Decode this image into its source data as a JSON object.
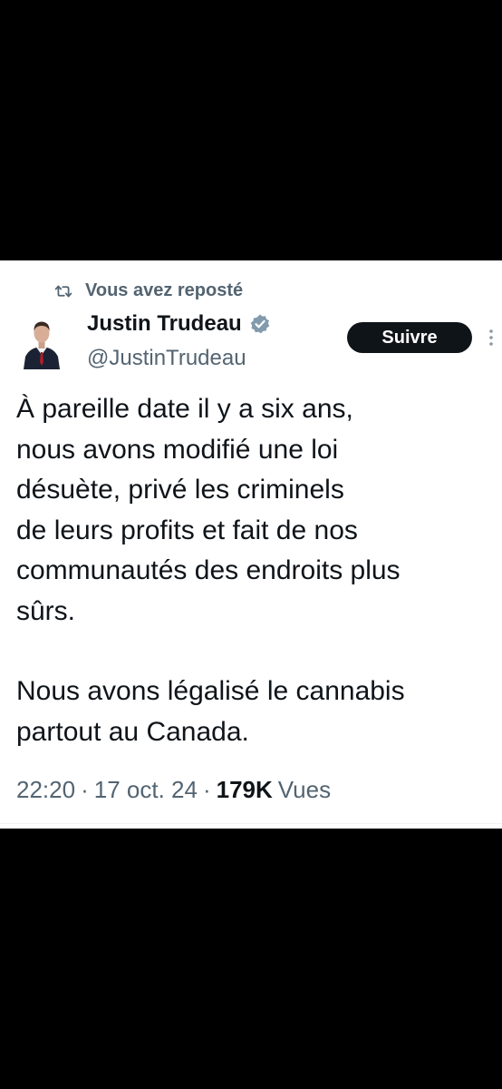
{
  "repost": {
    "label": "Vous avez reposté",
    "icon": "repost-icon"
  },
  "author": {
    "name": "Justin Trudeau",
    "handle": "@JustinTrudeau",
    "verified_icon": "verified-badge-icon",
    "verified_color": "#829aab"
  },
  "follow_button": {
    "label": "Suivre"
  },
  "more_menu": {
    "icon": "more-vertical-icon"
  },
  "tweet": {
    "paragraphs": [
      [
        "À pareille date il y a six ans,",
        "nous avons modifié une loi",
        "désuète, privé les criminels",
        "de leurs profits et fait de nos",
        "communautés des endroits plus",
        "sûrs."
      ],
      [
        "Nous avons légalisé le cannabis",
        "partout au Canada."
      ]
    ]
  },
  "meta": {
    "time": "22:20",
    "date": "17 oct. 24",
    "views_count": "179K",
    "views_label": "Vues",
    "separator": "·"
  },
  "colors": {
    "background": "#000000",
    "card": "#ffffff",
    "text_primary": "#0f1419",
    "text_secondary": "#536471",
    "button_bg": "#0f1419"
  }
}
